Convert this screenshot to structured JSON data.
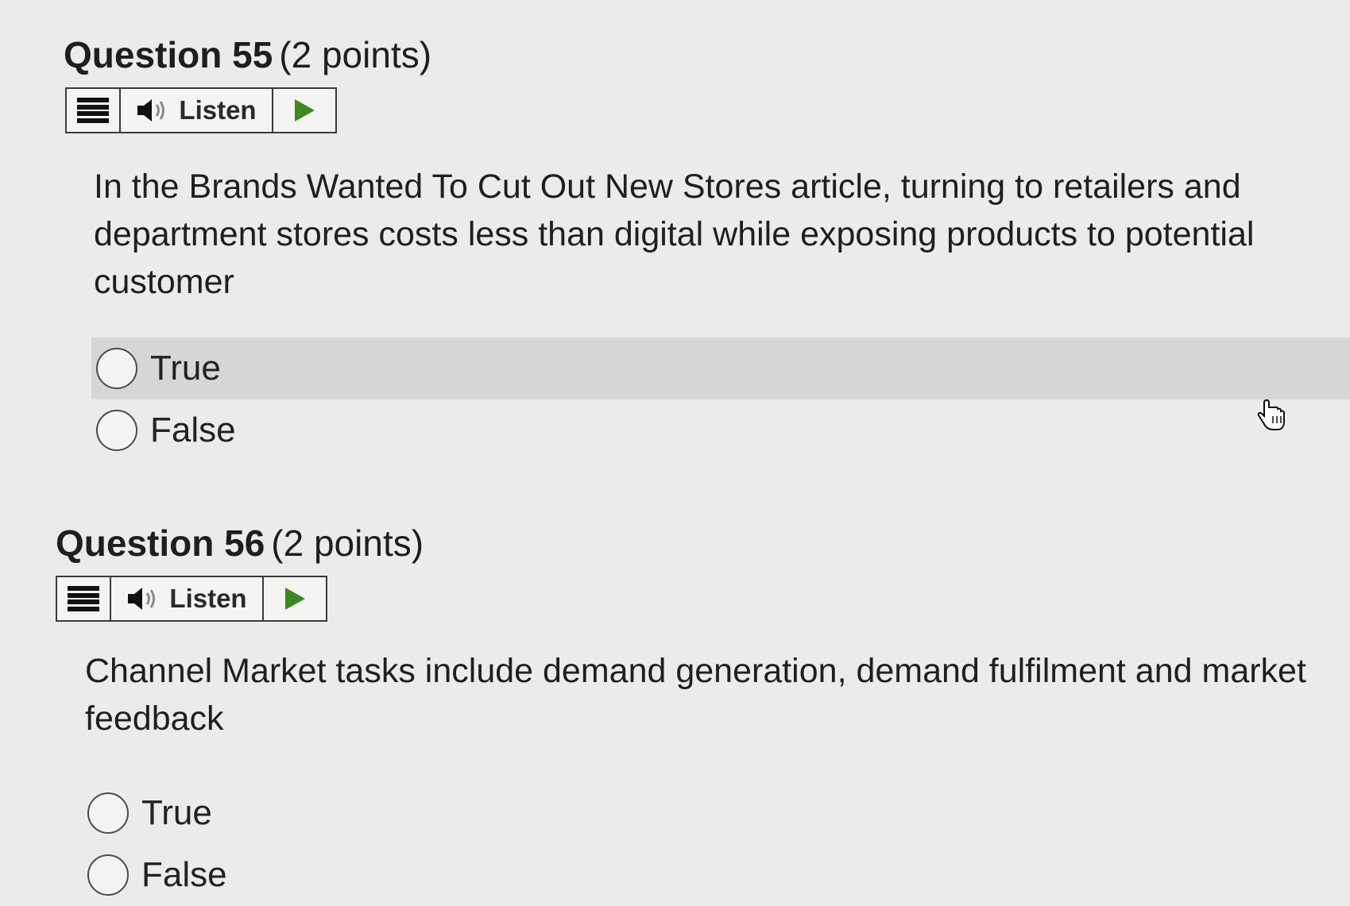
{
  "questions": [
    {
      "title": "Question 55",
      "points": "(2 points)",
      "listen_label": "Listen",
      "text": "In the Brands Wanted To Cut Out New Stores article, turning to retailers and department stores costs less than digital while exposing products to potential customer",
      "options": [
        "True",
        "False"
      ]
    },
    {
      "title": "Question 56",
      "points": "(2 points)",
      "listen_label": "Listen",
      "text": "Channel Market tasks include demand generation, demand fulfilment and market feedback",
      "options": [
        "True",
        "False"
      ]
    }
  ],
  "icons": {
    "menu": "menu-icon",
    "speaker": "speaker-icon",
    "play": "play-icon",
    "cursor": "hand-pointer-icon"
  },
  "colors": {
    "play_green": "#3a8a1f",
    "hover_row": "#d6d6d4"
  }
}
